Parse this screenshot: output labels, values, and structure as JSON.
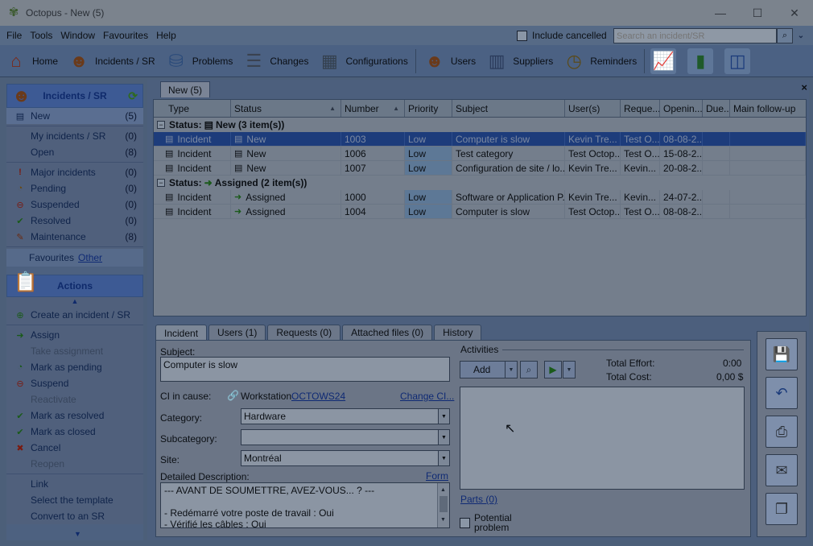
{
  "window": {
    "title": "Octopus - New (5)",
    "minimize": "—",
    "maximize": "☐",
    "close": "✕"
  },
  "menu": [
    "File",
    "Tools",
    "Window",
    "Favourites",
    "Help"
  ],
  "include_cancelled": "Include cancelled",
  "search": {
    "placeholder": "Search an incident/SR"
  },
  "toolbar": [
    {
      "label": "Home",
      "icon": "home-icon"
    },
    {
      "label": "Incidents / SR",
      "icon": "incidents-icon"
    },
    {
      "label": "Problems",
      "icon": "problems-icon"
    },
    {
      "label": "Changes",
      "icon": "changes-icon"
    },
    {
      "label": "Configurations",
      "icon": "configurations-icon"
    },
    {
      "label": "Users",
      "icon": "users-icon"
    },
    {
      "label": "Suppliers",
      "icon": "suppliers-icon"
    },
    {
      "label": "Reminders",
      "icon": "reminders-icon"
    }
  ],
  "left": {
    "header": "Incidents / SR",
    "nav": [
      {
        "label": "New",
        "count": "(5)",
        "icon": "new-icon"
      },
      {
        "label": "My incidents / SR",
        "count": "(0)",
        "icon": ""
      },
      {
        "label": "Open",
        "count": "(8)",
        "icon": ""
      },
      {
        "label": "Major incidents",
        "count": "(0)",
        "icon": "exclamation-icon"
      },
      {
        "label": "Pending",
        "count": "(0)",
        "icon": "pending-icon"
      },
      {
        "label": "Suspended",
        "count": "(0)",
        "icon": "suspended-icon"
      },
      {
        "label": "Resolved",
        "count": "(0)",
        "icon": "resolved-icon"
      },
      {
        "label": "Maintenance",
        "count": "(8)",
        "icon": "maintenance-icon"
      }
    ],
    "favourites": "Favourites",
    "favourites_other": "Other",
    "actions_header": "Actions",
    "actions": [
      {
        "label": "Create an incident / SR",
        "enabled": true
      },
      {
        "label": "Assign",
        "enabled": true
      },
      {
        "label": "Take assignment",
        "enabled": false
      },
      {
        "label": "Mark as pending",
        "enabled": true
      },
      {
        "label": "Suspend",
        "enabled": true
      },
      {
        "label": "Reactivate",
        "enabled": false
      },
      {
        "label": "Mark as resolved",
        "enabled": true
      },
      {
        "label": "Mark as closed",
        "enabled": true
      },
      {
        "label": "Cancel",
        "enabled": true
      },
      {
        "label": "Reopen",
        "enabled": false
      },
      {
        "label": "Link",
        "enabled": true
      },
      {
        "label": "Select the template",
        "enabled": true
      },
      {
        "label": "Convert to an SR",
        "enabled": true
      }
    ]
  },
  "tab": {
    "label": "New (5)",
    "close": "×"
  },
  "grid": {
    "columns": [
      "Type",
      "Status",
      "Number",
      "Priority",
      "Subject",
      "User(s)",
      "Reque...",
      "Openin...",
      "Due...",
      "Main follow-up"
    ],
    "groups": [
      {
        "label": "Status:",
        "status": "New (3 item(s))",
        "rows": [
          {
            "type": "Incident",
            "status": "New",
            "number": "1003",
            "priority": "Low",
            "subject": "Computer is slow",
            "users": "Kevin Tre...",
            "requester": "Test O...",
            "opening": "08-08-2...",
            "due": "",
            "followup": "",
            "selected": true
          },
          {
            "type": "Incident",
            "status": "New",
            "number": "1006",
            "priority": "Low",
            "subject": "Test category",
            "users": "Test Octop...",
            "requester": "Test O...",
            "opening": "15-08-2...",
            "due": "",
            "followup": ""
          },
          {
            "type": "Incident",
            "status": "New",
            "number": "1007",
            "priority": "Low",
            "subject": "Configuration de site / lo...",
            "users": "Kevin Tre...",
            "requester": "Kevin...",
            "opening": "20-08-2...",
            "due": "",
            "followup": ""
          }
        ]
      },
      {
        "label": "Status:",
        "status": "Assigned (2 item(s))",
        "rows": [
          {
            "type": "Incident",
            "status": "Assigned",
            "number": "1000",
            "priority": "Low",
            "subject": "Software or Application P...",
            "users": "Kevin Tre...",
            "requester": "Kevin...",
            "opening": "24-07-2...",
            "due": "",
            "followup": ""
          },
          {
            "type": "Incident",
            "status": "Assigned",
            "number": "1004",
            "priority": "Low",
            "subject": "Computer is slow",
            "users": "Test Octop...",
            "requester": "Test O...",
            "opening": "08-08-2...",
            "due": "",
            "followup": ""
          }
        ]
      }
    ]
  },
  "detail_tabs": [
    "Incident",
    "Users (1)",
    "Requests (0)",
    "Attached files (0)",
    "History"
  ],
  "detail": {
    "subject_label": "Subject:",
    "subject": "Computer is slow",
    "ci_label": "CI in cause:",
    "ci_prefix": "Workstation",
    "ci_value": "OCTOWS24",
    "change_ci": "Change CI...",
    "category_label": "Category:",
    "category": "Hardware",
    "subcategory_label": "Subcategory:",
    "subcategory": "",
    "site_label": "Site:",
    "site": "Montréal",
    "desc_label": "Detailed Description:",
    "form_link": "Form",
    "desc_lines": [
      "--- AVANT DE SOUMETTRE, AVEZ-VOUS... ? ---",
      "",
      "- Redémarré votre poste de travail : Oui",
      "- Vérifié les câbles : Oui"
    ],
    "activities_label": "Activities",
    "add_label": "Add",
    "total_effort_label": "Total Effort:",
    "total_effort": "0:00",
    "total_cost_label": "Total Cost:",
    "total_cost": "0,00 $",
    "parts": "Parts (0)",
    "potential_line1": "Potential",
    "potential_line2": "problem"
  }
}
